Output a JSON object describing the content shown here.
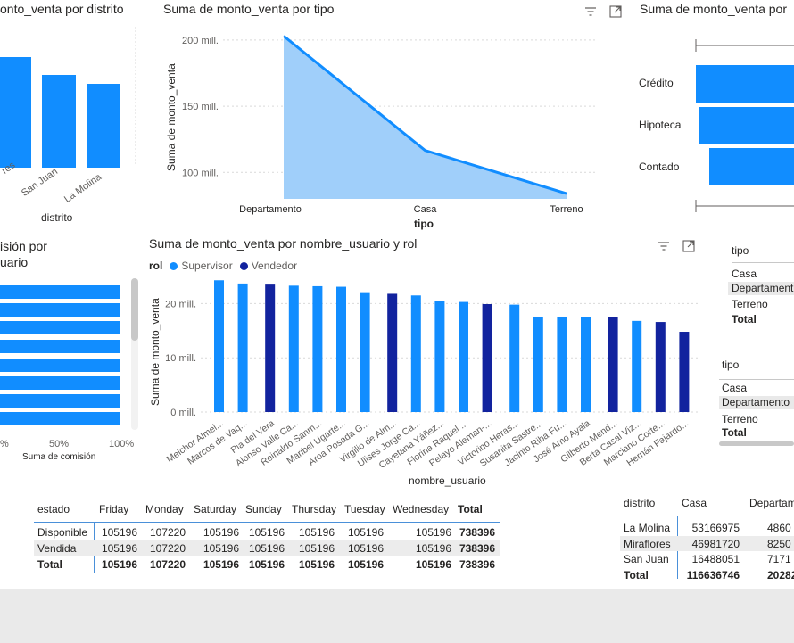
{
  "visuals": {
    "distrito_chart": {
      "title": "onto_venta por distrito",
      "xlabel": "distrito",
      "categories": [
        "res",
        "San Juan",
        "La Molina"
      ]
    },
    "tipo_area_chart": {
      "title": "Suma de monto_venta por tipo",
      "ylabel": "Suma de monto_venta",
      "xlabel": "tipo"
    },
    "tipo_bar_chart": {
      "title": "Suma de monto_venta por",
      "categories": [
        "Crédito",
        "Hipoteca",
        "Contado"
      ]
    },
    "comision_chart": {
      "title_line1": "isión por",
      "title_line2": "uario",
      "xlabel": "Suma de comisión",
      "ticks": [
        "%",
        "50%",
        "100%"
      ]
    },
    "usuario_chart": {
      "title": "Suma de monto_venta por nombre_usuario y rol",
      "legend_title": "rol",
      "legend": [
        {
          "name": "Supervisor",
          "color": "#118dff"
        },
        {
          "name": "Vendedor",
          "color": "#12239e"
        }
      ],
      "ylabel": "Suma de monto_venta",
      "xlabel": "nombre_usuario"
    }
  },
  "chart_data": [
    {
      "type": "area",
      "title": "Suma de monto_venta por tipo",
      "xlabel": "tipo",
      "ylabel": "Suma de monto_venta",
      "categories": [
        "Departamento",
        "Casa",
        "Terreno"
      ],
      "values": [
        203,
        116.6,
        84
      ],
      "ytick_labels": [
        "100 mill.",
        "150 mill.",
        "200 mill."
      ],
      "yticks": [
        100,
        150,
        200
      ],
      "ylim": [
        80,
        210
      ],
      "color": "#118dff"
    },
    {
      "type": "bar",
      "title": "Suma de monto_venta por nombre_usuario y rol",
      "xlabel": "nombre_usuario",
      "ylabel": "Suma de monto_venta",
      "ytick_labels": [
        "0 mill.",
        "10 mill.",
        "20 mill."
      ],
      "yticks": [
        0,
        10,
        20
      ],
      "ylim": [
        0,
        25
      ],
      "categories": [
        "Melchor Almei...",
        "Marcos de Vaq...",
        "Pia del Vera",
        "Alonso Valle Ca...",
        "Reinaldo Sanm...",
        "Maribel Ugarte...",
        "Aroa Posada G...",
        "Virgilio de Alm...",
        "Ulises Jorge Ca...",
        "Cayetana Yáñez...",
        "Florina Raquel ...",
        "Pelayo Aleman-...",
        "Victorino Heras...",
        "Susanita Sastre...",
        "Jacinto Riba Fu...",
        "José Amo Ayala",
        "Gilberto Mend...",
        "Berta Casal Viz...",
        "Marciano Corte...",
        "Hernán Fajardo..."
      ],
      "values": [
        24.3,
        23.7,
        23.5,
        23.3,
        23.2,
        23.1,
        22.1,
        21.8,
        21.5,
        20.5,
        20.3,
        19.9,
        19.8,
        17.6,
        17.6,
        17.5,
        17.5,
        16.8,
        16.6,
        14.8
      ],
      "roles": [
        "Supervisor",
        "Supervisor",
        "Vendedor",
        "Supervisor",
        "Supervisor",
        "Supervisor",
        "Supervisor",
        "Vendedor",
        "Supervisor",
        "Supervisor",
        "Supervisor",
        "Vendedor",
        "Supervisor",
        "Supervisor",
        "Supervisor",
        "Supervisor",
        "Vendedor",
        "Supervisor",
        "Vendedor",
        "Vendedor"
      ]
    }
  ],
  "estado_table": {
    "headers": [
      "estado",
      "Friday",
      "Monday",
      "Saturday",
      "Sunday",
      "Thursday",
      "Tuesday",
      "Wednesday",
      "Total"
    ],
    "rows": [
      [
        "Disponible",
        "105196",
        "107220",
        "105196",
        "105196",
        "105196",
        "105196",
        "105196",
        "738396"
      ],
      [
        "Vendida",
        "105196",
        "107220",
        "105196",
        "105196",
        "105196",
        "105196",
        "105196",
        "738396"
      ],
      [
        "Total",
        "105196",
        "107220",
        "105196",
        "105196",
        "105196",
        "105196",
        "105196",
        "738396"
      ]
    ]
  },
  "distrito_table": {
    "headers": [
      "distrito",
      "Casa",
      "Departam"
    ],
    "rows": [
      [
        "La Molina",
        "53166975",
        "4860"
      ],
      [
        "Miraflores",
        "46981720",
        "8250"
      ],
      [
        "San Juan",
        "16488051",
        "7171"
      ],
      [
        "Total",
        "116636746",
        "20282"
      ]
    ]
  },
  "slicer1": {
    "title": "tipo",
    "items": [
      "Casa",
      "Departament",
      "Terreno",
      "Total"
    ]
  },
  "slicer2": {
    "title": "tipo",
    "items": [
      "Casa",
      "Departamento",
      "Terreno",
      "Total"
    ]
  },
  "colors": {
    "supervisor": "#118dff",
    "vendedor": "#12239e",
    "area_fill": "#a0cffa"
  },
  "icons": [
    "filter-icon",
    "focus-mode-icon"
  ]
}
